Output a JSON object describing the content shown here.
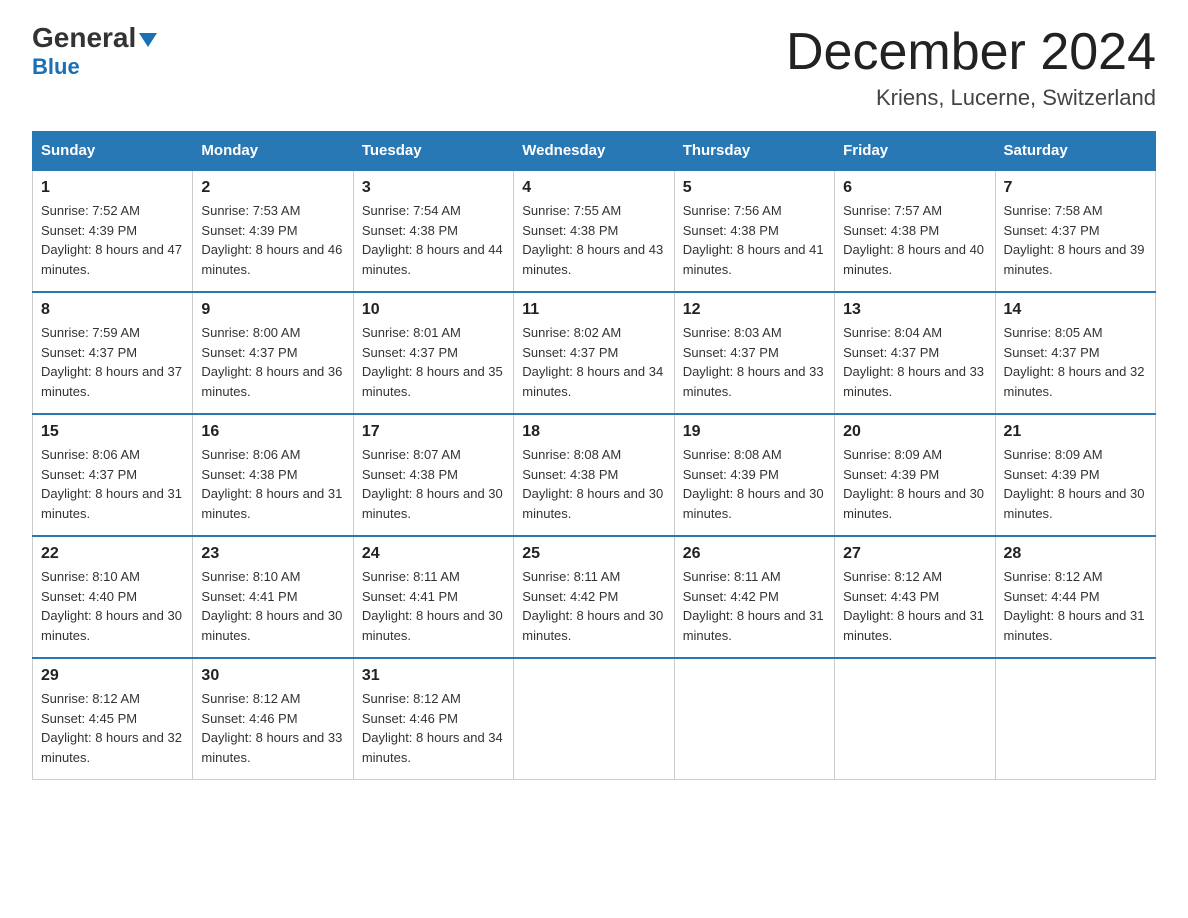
{
  "logo": {
    "general": "General",
    "blue": "Blue",
    "triangle": "▼"
  },
  "title": "December 2024",
  "location": "Kriens, Lucerne, Switzerland",
  "days_of_week": [
    "Sunday",
    "Monday",
    "Tuesday",
    "Wednesday",
    "Thursday",
    "Friday",
    "Saturday"
  ],
  "weeks": [
    [
      {
        "day": "1",
        "sunrise": "7:52 AM",
        "sunset": "4:39 PM",
        "daylight": "8 hours and 47 minutes."
      },
      {
        "day": "2",
        "sunrise": "7:53 AM",
        "sunset": "4:39 PM",
        "daylight": "8 hours and 46 minutes."
      },
      {
        "day": "3",
        "sunrise": "7:54 AM",
        "sunset": "4:38 PM",
        "daylight": "8 hours and 44 minutes."
      },
      {
        "day": "4",
        "sunrise": "7:55 AM",
        "sunset": "4:38 PM",
        "daylight": "8 hours and 43 minutes."
      },
      {
        "day": "5",
        "sunrise": "7:56 AM",
        "sunset": "4:38 PM",
        "daylight": "8 hours and 41 minutes."
      },
      {
        "day": "6",
        "sunrise": "7:57 AM",
        "sunset": "4:38 PM",
        "daylight": "8 hours and 40 minutes."
      },
      {
        "day": "7",
        "sunrise": "7:58 AM",
        "sunset": "4:37 PM",
        "daylight": "8 hours and 39 minutes."
      }
    ],
    [
      {
        "day": "8",
        "sunrise": "7:59 AM",
        "sunset": "4:37 PM",
        "daylight": "8 hours and 37 minutes."
      },
      {
        "day": "9",
        "sunrise": "8:00 AM",
        "sunset": "4:37 PM",
        "daylight": "8 hours and 36 minutes."
      },
      {
        "day": "10",
        "sunrise": "8:01 AM",
        "sunset": "4:37 PM",
        "daylight": "8 hours and 35 minutes."
      },
      {
        "day": "11",
        "sunrise": "8:02 AM",
        "sunset": "4:37 PM",
        "daylight": "8 hours and 34 minutes."
      },
      {
        "day": "12",
        "sunrise": "8:03 AM",
        "sunset": "4:37 PM",
        "daylight": "8 hours and 33 minutes."
      },
      {
        "day": "13",
        "sunrise": "8:04 AM",
        "sunset": "4:37 PM",
        "daylight": "8 hours and 33 minutes."
      },
      {
        "day": "14",
        "sunrise": "8:05 AM",
        "sunset": "4:37 PM",
        "daylight": "8 hours and 32 minutes."
      }
    ],
    [
      {
        "day": "15",
        "sunrise": "8:06 AM",
        "sunset": "4:37 PM",
        "daylight": "8 hours and 31 minutes."
      },
      {
        "day": "16",
        "sunrise": "8:06 AM",
        "sunset": "4:38 PM",
        "daylight": "8 hours and 31 minutes."
      },
      {
        "day": "17",
        "sunrise": "8:07 AM",
        "sunset": "4:38 PM",
        "daylight": "8 hours and 30 minutes."
      },
      {
        "day": "18",
        "sunrise": "8:08 AM",
        "sunset": "4:38 PM",
        "daylight": "8 hours and 30 minutes."
      },
      {
        "day": "19",
        "sunrise": "8:08 AM",
        "sunset": "4:39 PM",
        "daylight": "8 hours and 30 minutes."
      },
      {
        "day": "20",
        "sunrise": "8:09 AM",
        "sunset": "4:39 PM",
        "daylight": "8 hours and 30 minutes."
      },
      {
        "day": "21",
        "sunrise": "8:09 AM",
        "sunset": "4:39 PM",
        "daylight": "8 hours and 30 minutes."
      }
    ],
    [
      {
        "day": "22",
        "sunrise": "8:10 AM",
        "sunset": "4:40 PM",
        "daylight": "8 hours and 30 minutes."
      },
      {
        "day": "23",
        "sunrise": "8:10 AM",
        "sunset": "4:41 PM",
        "daylight": "8 hours and 30 minutes."
      },
      {
        "day": "24",
        "sunrise": "8:11 AM",
        "sunset": "4:41 PM",
        "daylight": "8 hours and 30 minutes."
      },
      {
        "day": "25",
        "sunrise": "8:11 AM",
        "sunset": "4:42 PM",
        "daylight": "8 hours and 30 minutes."
      },
      {
        "day": "26",
        "sunrise": "8:11 AM",
        "sunset": "4:42 PM",
        "daylight": "8 hours and 31 minutes."
      },
      {
        "day": "27",
        "sunrise": "8:12 AM",
        "sunset": "4:43 PM",
        "daylight": "8 hours and 31 minutes."
      },
      {
        "day": "28",
        "sunrise": "8:12 AM",
        "sunset": "4:44 PM",
        "daylight": "8 hours and 31 minutes."
      }
    ],
    [
      {
        "day": "29",
        "sunrise": "8:12 AM",
        "sunset": "4:45 PM",
        "daylight": "8 hours and 32 minutes."
      },
      {
        "day": "30",
        "sunrise": "8:12 AM",
        "sunset": "4:46 PM",
        "daylight": "8 hours and 33 minutes."
      },
      {
        "day": "31",
        "sunrise": "8:12 AM",
        "sunset": "4:46 PM",
        "daylight": "8 hours and 34 minutes."
      },
      null,
      null,
      null,
      null
    ]
  ]
}
